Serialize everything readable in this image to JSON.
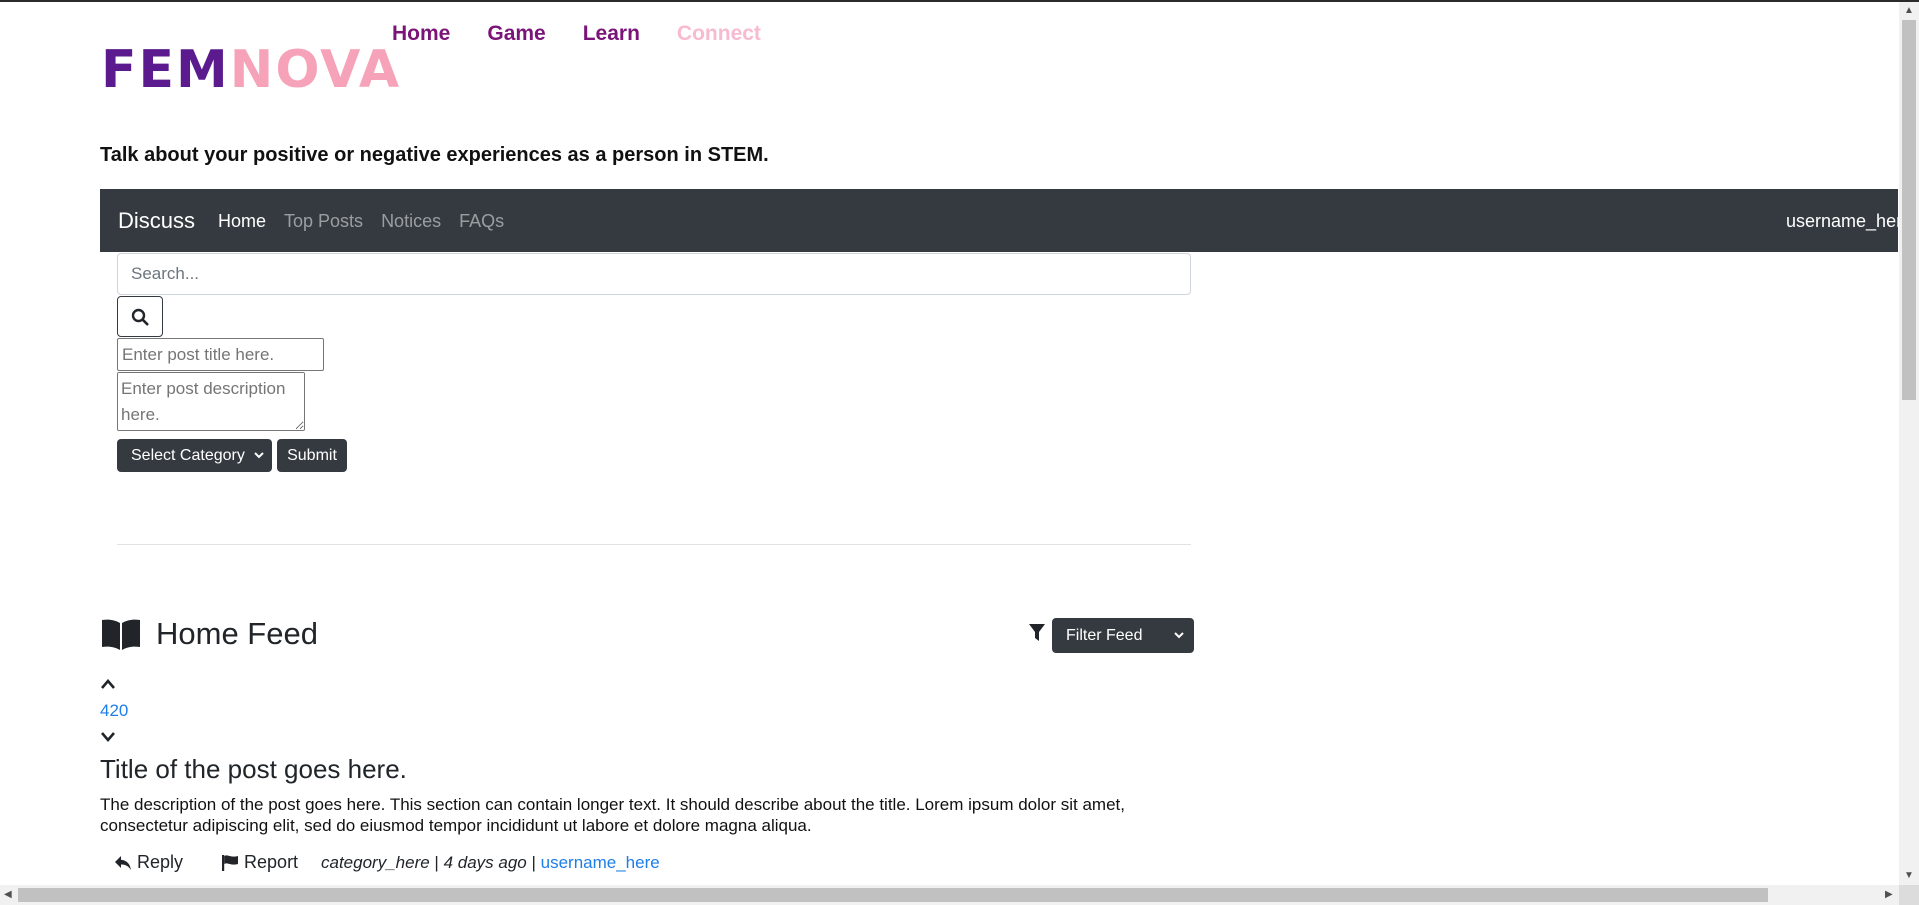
{
  "brand": {
    "part1": "FEM",
    "part2": "NOVA"
  },
  "site_nav": [
    {
      "label": "Home"
    },
    {
      "label": "Game"
    },
    {
      "label": "Learn"
    },
    {
      "label": "Connect"
    }
  ],
  "tagline": "Talk about your positive or negative experiences as a person in STEM.",
  "navbar": {
    "brand": "Discuss",
    "links": [
      {
        "label": "Home"
      },
      {
        "label": "Top Posts"
      },
      {
        "label": "Notices"
      },
      {
        "label": "FAQs"
      }
    ],
    "user": "username_here"
  },
  "search": {
    "placeholder": "Search...",
    "value": ""
  },
  "new_post": {
    "title_placeholder": "Enter post title here.",
    "description_placeholder": "Enter post description here.",
    "category_label": "Select Category",
    "submit_label": "Submit"
  },
  "feed": {
    "title": "Home Feed",
    "filter_label": "Filter Feed",
    "posts": [
      {
        "votes": "420",
        "title": "Title of the post goes here.",
        "description": "The description of the post goes here. This section can contain longer text. It should describe about the title. Lorem ipsum dolor sit amet, consectetur adipiscing elit, sed do eiusmod tempor incididunt ut labore et dolore magna aliqua.",
        "reply_label": "Reply",
        "report_label": "Report",
        "category": "category_here",
        "separator": "|",
        "time": "4 days ago",
        "author": "username_here"
      }
    ]
  },
  "icons": {
    "search": "search-icon",
    "book": "book-open-icon",
    "filter": "filter-icon",
    "upvote": "chevron-up-icon",
    "downvote": "chevron-down-icon",
    "reply": "reply-icon",
    "report": "flag-icon"
  },
  "colors": {
    "brand_purple": "#5b1a8e",
    "brand_pink": "#f6a2b8",
    "nav_link": "#7b1478",
    "nav_active": "#f8bad0",
    "navbar_bg": "#343a40",
    "link_blue": "#1e7ee8"
  }
}
